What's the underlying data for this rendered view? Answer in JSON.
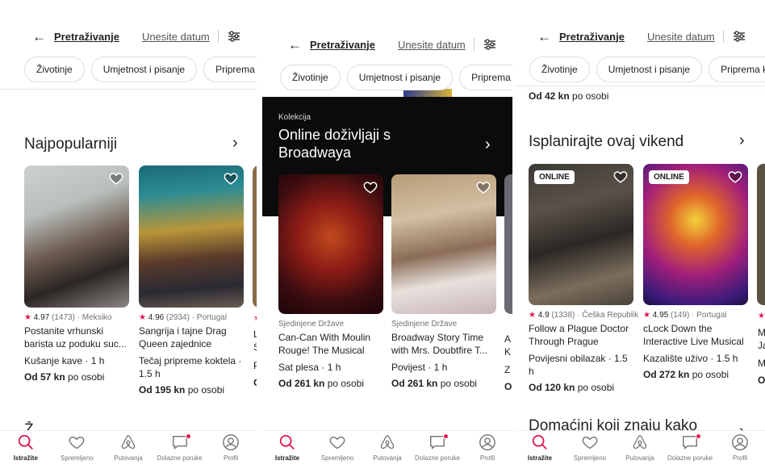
{
  "header": {
    "back_icon": "arrow-left-icon",
    "search_label": "Pretraživanje",
    "date_label": "Unesite datum",
    "filter_icon": "sliders-icon"
  },
  "chips": [
    "Životinje",
    "Umjetnost i pisanje",
    "Priprema ko"
  ],
  "panel1": {
    "section_title": "Najpopularniji",
    "cards": [
      {
        "rating": "4.97",
        "reviews": "(1473)",
        "location": "· Meksiko",
        "title": "Postanite vrhunski barista uz poduku suc...",
        "meta": "Kušanje kave · 1 h",
        "price_prefix": "Od 57 kn",
        "price_suffix": " po osobi"
      },
      {
        "rating": "4.96",
        "reviews": "(2934)",
        "location": "· Portugal",
        "title": "Sangrija i tajne Drag Queen zajednice",
        "meta": "Tečaj pripreme koktela · 1.5 h",
        "price_prefix": "Od 195 kn",
        "price_suffix": " po osobi"
      }
    ],
    "partial_lines": [
      "Li",
      "Sc",
      "Pc",
      "O"
    ],
    "next_section_partial": "Ž"
  },
  "panel2": {
    "kicker": "Kolekcija",
    "title": "Online doživljaji s Broadwaya",
    "cards": [
      {
        "location": "Sjedinjene Države",
        "title": "Can-Can With Moulin Rouge! The Musical",
        "meta": "Sat plesa · 1 h",
        "price_prefix": "Od 261 kn",
        "price_suffix": " po osobi"
      },
      {
        "location": "Sjedinjene Države",
        "title": "Broadway Story Time with Mrs. Doubtfire T...",
        "meta": "Povijest · 1 h",
        "price_prefix": "Od 261 kn",
        "price_suffix": " po osobi"
      }
    ],
    "partial_lines": [
      "A",
      "K",
      "Z",
      "O"
    ]
  },
  "panel3": {
    "top_price_prefix": "Od 42 kn",
    "top_price_suffix": " po osobi",
    "section_title": "Isplanirajte ovaj vikend",
    "badge": "ONLINE",
    "cards": [
      {
        "rating": "4.9",
        "reviews": "(1338)",
        "location": "· Češka Republik",
        "title": "Follow a Plague Doctor Through Prague",
        "meta": "Povijesni obilazak · 1.5 h",
        "price_prefix": "Od 120 kn",
        "price_suffix": " po osobi"
      },
      {
        "rating": "4.95",
        "reviews": "(149)",
        "location": "· Portugal",
        "title": "cLock Down the Interactive Live Musical",
        "meta": "Kazalište uživo · 1.5 h",
        "price_prefix": "Od 272 kn",
        "price_suffix": " po osobi"
      }
    ],
    "partial_lines": [
      "M",
      "Ja",
      "M",
      "O"
    ],
    "next_section_title": "Domaćini koji znaju kako"
  },
  "nav": [
    {
      "label": "Istražite",
      "icon": "search-icon"
    },
    {
      "label": "Spremljeno",
      "icon": "heart-icon"
    },
    {
      "label": "Putovanja",
      "icon": "airbnb-logo-icon"
    },
    {
      "label": "Dolazne poruke",
      "icon": "message-icon"
    },
    {
      "label": "Profil",
      "icon": "user-circle-icon"
    }
  ],
  "colors": {
    "accent": "#e0174e",
    "text": "#222222",
    "muted": "#717171",
    "collection_bg": "#0b0b0b"
  }
}
